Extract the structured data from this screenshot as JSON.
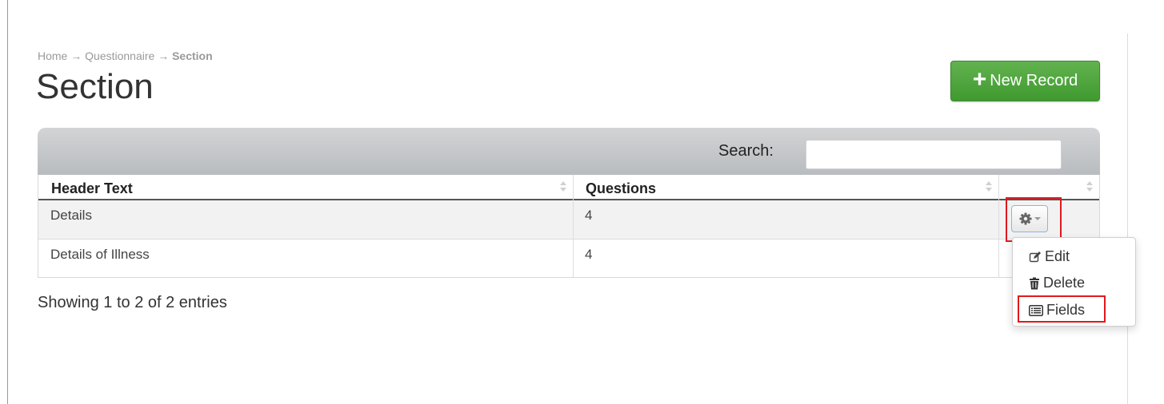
{
  "breadcrumb": {
    "home": "Home",
    "separator": "→",
    "parent": "Questionnaire",
    "current": "Section"
  },
  "page": {
    "title": "Section"
  },
  "actions": {
    "new_record_icon": "+",
    "new_record_label": "New Record"
  },
  "table": {
    "search_label": "Search:",
    "search_value": "",
    "columns": [
      "Header Text",
      "Questions",
      ""
    ],
    "rows": [
      {
        "header_text": "Details",
        "questions": "4"
      },
      {
        "header_text": "Details of Illness",
        "questions": "4"
      }
    ],
    "info": "Showing 1 to 2 of 2 entries"
  },
  "row_menu": {
    "button_icon": "gear-icon",
    "items": [
      {
        "label": "Edit",
        "icon": "edit-icon"
      },
      {
        "label": "Delete",
        "icon": "trash-icon"
      },
      {
        "label": "Fields",
        "icon": "list-icon"
      }
    ]
  },
  "colors": {
    "primary_button": "#4ca63a",
    "highlight": "#e0191e",
    "toolbar": "#c3c5c7"
  }
}
